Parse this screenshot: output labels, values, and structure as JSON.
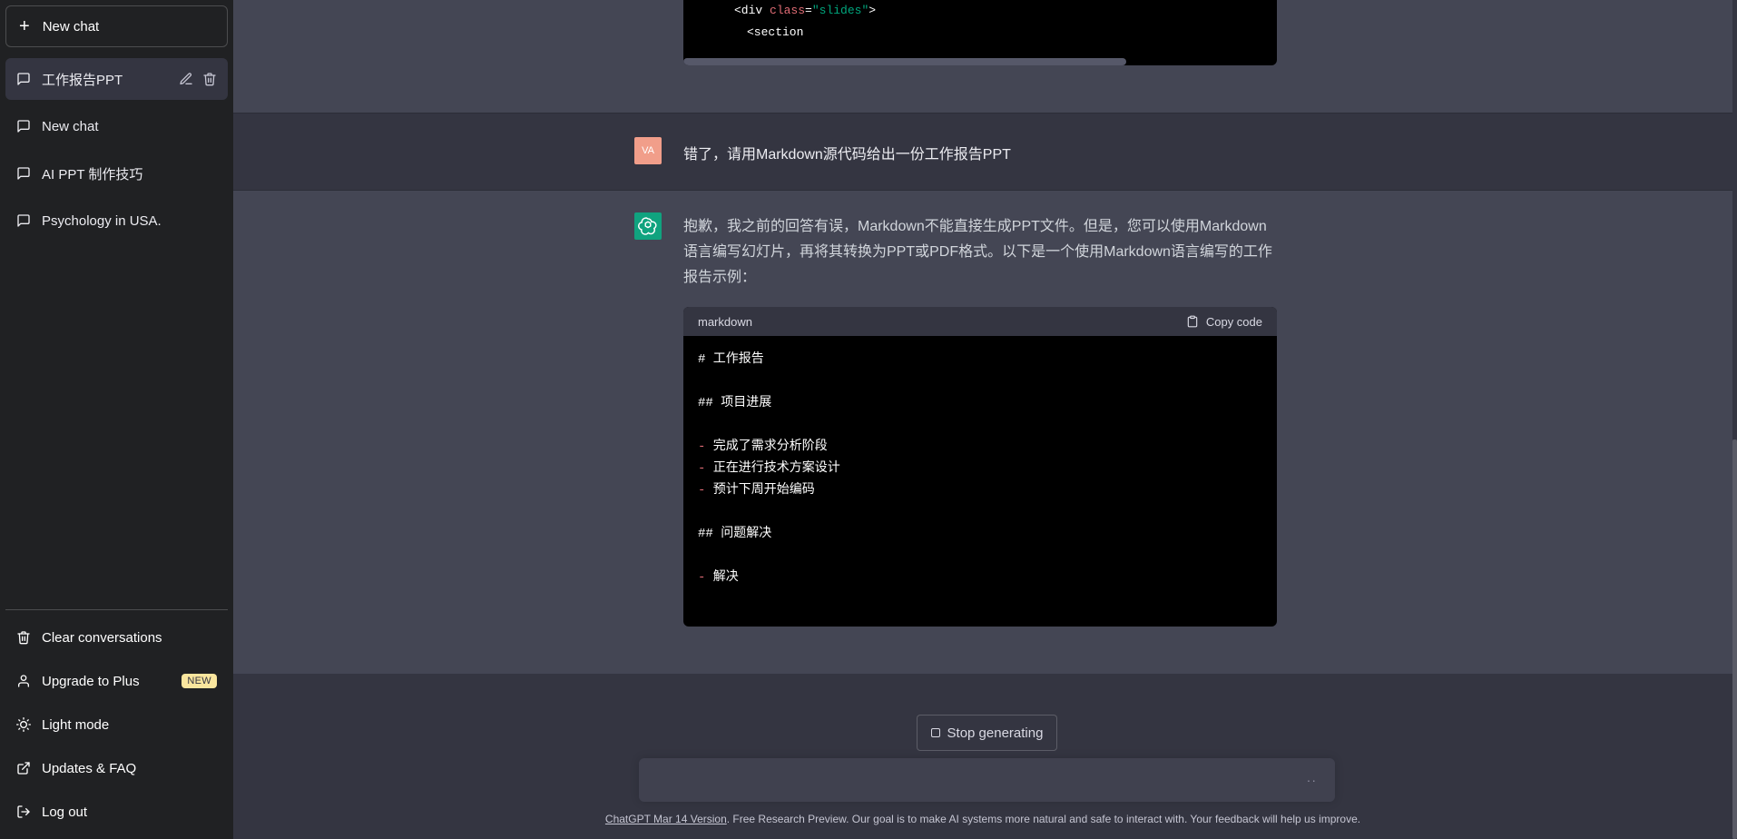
{
  "sidebar": {
    "new_chat_label": "New chat",
    "chats": [
      {
        "label": "工作报告PPT",
        "active": true
      },
      {
        "label": "New chat",
        "active": false
      },
      {
        "label": "AI PPT 制作技巧",
        "active": false
      },
      {
        "label": "Psychology in USA.",
        "active": false
      }
    ],
    "menu": {
      "clear": "Clear conversations",
      "upgrade": "Upgrade to Plus",
      "upgrade_badge": "NEW",
      "light_mode": "Light mode",
      "updates": "Updates & FAQ",
      "logout": "Log out"
    }
  },
  "conversation": {
    "partial_code_lines": [
      "<div class=\"slides\">",
      "<section"
    ],
    "user_avatar": "VA",
    "user_message": "错了，请用Markdown源代码给出一份工作报告PPT",
    "assistant_message": "抱歉，我之前的回答有误，Markdown不能直接生成PPT文件。但是，您可以使用Markdown语言编写幻灯片，再将其转换为PPT或PDF格式。以下是一个使用Markdown语言编写的工作报告示例：",
    "code_block": {
      "language": "markdown",
      "copy_label": "Copy code",
      "lines": [
        {
          "prefix": "",
          "text": "# 工作报告"
        },
        {
          "prefix": "",
          "text": ""
        },
        {
          "prefix": "",
          "text": "## 项目进展"
        },
        {
          "prefix": "",
          "text": ""
        },
        {
          "prefix": "-",
          "text": " 完成了需求分析阶段"
        },
        {
          "prefix": "-",
          "text": " 正在进行技术方案设计"
        },
        {
          "prefix": "-",
          "text": " 预计下周开始编码"
        },
        {
          "prefix": "",
          "text": ""
        },
        {
          "prefix": "",
          "text": "## 问题解决"
        },
        {
          "prefix": "",
          "text": ""
        },
        {
          "prefix": "-",
          "text": " 解决"
        }
      ]
    }
  },
  "composer": {
    "stop_label": "Stop generating",
    "typing_indicator": "··",
    "input_value": ""
  },
  "footer": {
    "link_text": "ChatGPT Mar 14 Version",
    "note": ". Free Research Preview. Our goal is to make AI systems more natural and safe to interact with. Your feedback will help us improve."
  },
  "colors": {
    "sidebar_bg": "#202123",
    "main_bg": "#343541",
    "assistant_bg": "#444654",
    "gpt_avatar": "#10a37f",
    "user_avatar": "#f19e8a",
    "badge": "#fae69e"
  }
}
